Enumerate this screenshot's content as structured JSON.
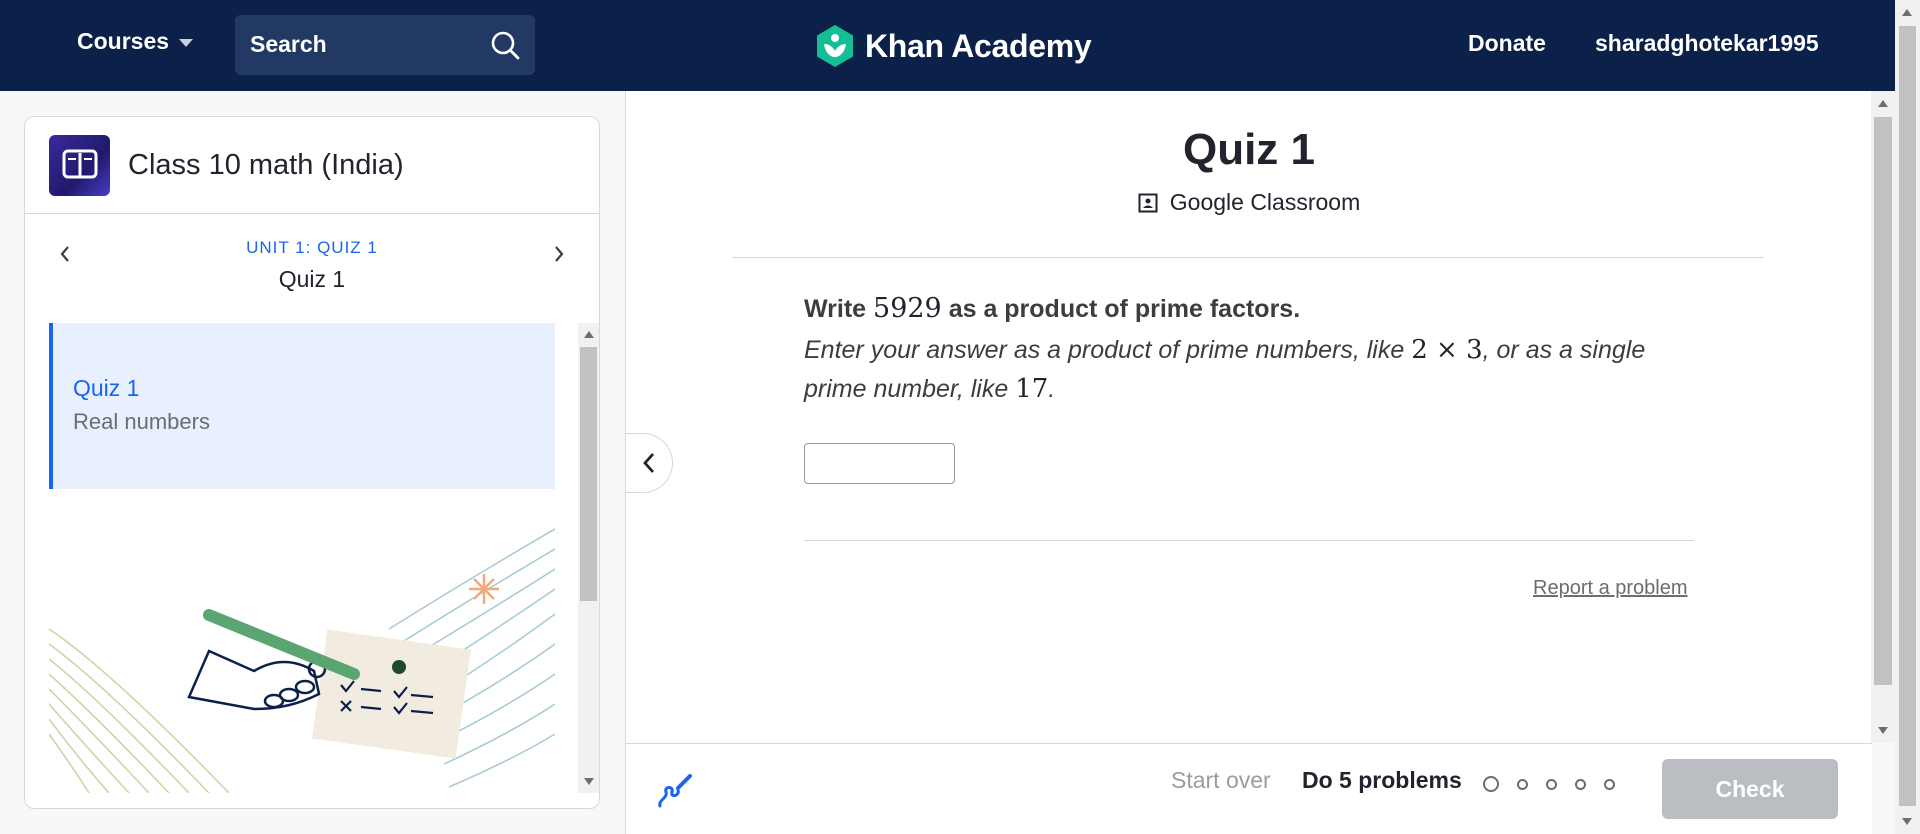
{
  "header": {
    "courses_label": "Courses",
    "search_label": "Search",
    "brand": "Khan Academy",
    "donate_label": "Donate",
    "username": "sharadghotekar1995"
  },
  "sidebar": {
    "course_title": "Class 10 math (India)",
    "unit_label": "UNIT 1: QUIZ 1",
    "unit_title": "Quiz 1",
    "items": [
      {
        "title": "Quiz 1",
        "subtitle": "Real numbers"
      }
    ]
  },
  "main": {
    "title": "Quiz 1",
    "google_classroom_label": "Google Classroom",
    "question": {
      "prefix": "Write",
      "number": "5929",
      "suffix": "as a product of prime factors.",
      "instruction_part1": "Enter your answer as a product of prime numbers, like",
      "example_product": "2 × 3",
      "instruction_part2": ", or as a single prime number, like",
      "example_prime": "17",
      "instruction_end": "."
    },
    "answer_value": "",
    "report_label": "Report a problem"
  },
  "footer": {
    "start_over_label": "Start over",
    "problems_label": "Do 5 problems",
    "progress": {
      "completed": 0,
      "total": 5
    },
    "check_label": "Check"
  },
  "colors": {
    "nav_bg": "#0b2149",
    "accent_blue": "#1865f2",
    "brand_green": "#14bf96",
    "check_disabled": "#babec2",
    "selected_item_bg": "#e8f0fe"
  }
}
